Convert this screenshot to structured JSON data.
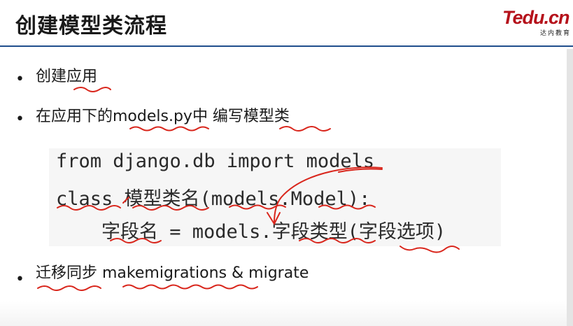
{
  "slide": {
    "title": "创建模型类流程",
    "logo": {
      "main": "Tedu.cn",
      "sub": "达内教育"
    },
    "bullets": [
      {
        "text": "创建应用"
      },
      {
        "text": "在应用下的models.py中 编写模型类"
      },
      {
        "text": "迁移同步  makemigrations & migrate"
      }
    ],
    "code": {
      "lines": [
        "from django.db import models",
        "class 模型类名(models.Model):",
        "    字段名 = models.字段类型(字段选项)"
      ]
    }
  },
  "annotation_color": "#d9261c",
  "accent_color": "#1f4e8c"
}
